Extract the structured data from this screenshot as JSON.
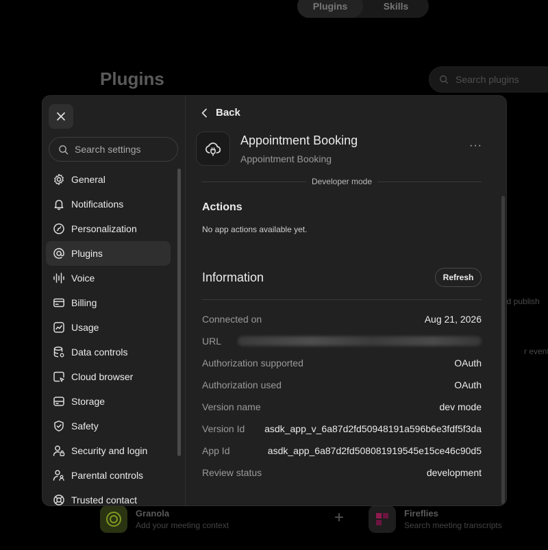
{
  "background": {
    "tabs": [
      {
        "label": "Plugins",
        "active": true
      },
      {
        "label": "Skills",
        "active": false
      }
    ],
    "title": "Plugins",
    "search_placeholder": "Search plugins",
    "fragments": [
      "nd publish",
      "r events a"
    ],
    "apps": [
      {
        "name": "Granola",
        "desc": "Add your meeting context",
        "color": "#9fc22e"
      },
      {
        "name": "Fireflies",
        "desc": "Search meeting transcripts",
        "color": "#c21e68"
      }
    ],
    "plus": "+"
  },
  "sidebar": {
    "search_placeholder": "Search settings",
    "items": [
      {
        "label": "General",
        "icon": "gear-icon"
      },
      {
        "label": "Notifications",
        "icon": "bell-icon"
      },
      {
        "label": "Personalization",
        "icon": "personalization-icon"
      },
      {
        "label": "Plugins",
        "icon": "at-sign-icon",
        "active": true
      },
      {
        "label": "Voice",
        "icon": "waveform-icon"
      },
      {
        "label": "Billing",
        "icon": "credit-card-icon"
      },
      {
        "label": "Usage",
        "icon": "chart-icon"
      },
      {
        "label": "Data controls",
        "icon": "database-icon"
      },
      {
        "label": "Cloud browser",
        "icon": "browser-icon"
      },
      {
        "label": "Storage",
        "icon": "storage-icon"
      },
      {
        "label": "Safety",
        "icon": "shield-icon"
      },
      {
        "label": "Security and login",
        "icon": "user-lock-icon"
      },
      {
        "label": "Parental controls",
        "icon": "parent-icon"
      },
      {
        "label": "Trusted contact",
        "icon": "lifebuoy-icon"
      }
    ]
  },
  "content": {
    "back_label": "Back",
    "app_title": "Appointment Booking",
    "app_subtitle": "Appointment Booking",
    "more_label": "···",
    "developer_mode": "Developer mode",
    "actions_title": "Actions",
    "actions_empty": "No app actions available yet.",
    "information_title": "Information",
    "refresh_label": "Refresh",
    "info": [
      {
        "label": "Connected on",
        "value": "Aug 21, 2026"
      },
      {
        "label": "URL",
        "value": ""
      },
      {
        "label": "Authorization supported",
        "value": "OAuth"
      },
      {
        "label": "Authorization used",
        "value": "OAuth"
      },
      {
        "label": "Version name",
        "value": "dev mode"
      },
      {
        "label": "Version Id",
        "value": "asdk_app_v_6a87d2fd50948191a596b6e3fdf5f3da"
      },
      {
        "label": "App Id",
        "value": "asdk_app_6a87d2fd508081919545e15ce46c90d5"
      },
      {
        "label": "Review status",
        "value": "development"
      }
    ]
  }
}
